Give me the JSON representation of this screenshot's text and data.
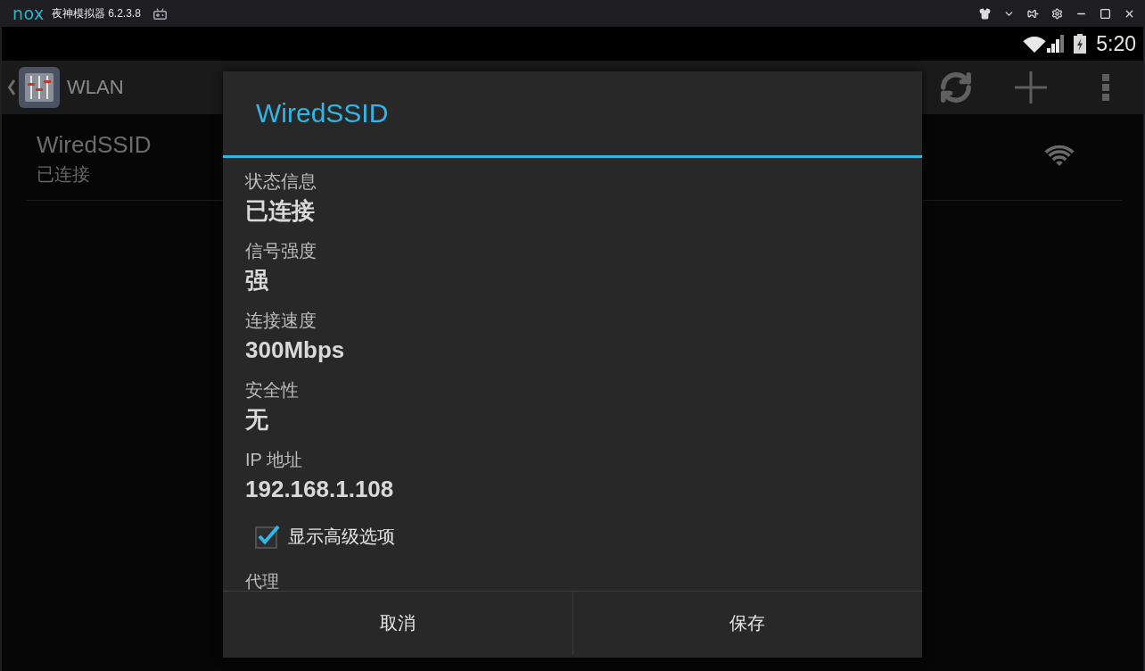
{
  "window": {
    "logo": "nox",
    "title": "夜神模拟器 6.2.3.8"
  },
  "status_bar": {
    "time": "5:20"
  },
  "action_bar": {
    "title": "WLAN"
  },
  "networks": [
    {
      "name": "WiredSSID",
      "status": "已连接"
    }
  ],
  "dialog": {
    "title": "WiredSSID",
    "fields": [
      {
        "label": "状态信息",
        "value": "已连接"
      },
      {
        "label": "信号强度",
        "value": "强"
      },
      {
        "label": "连接速度",
        "value": "300Mbps"
      },
      {
        "label": "安全性",
        "value": "无"
      },
      {
        "label": "IP 地址",
        "value": "192.168.1.108"
      }
    ],
    "show_advanced": {
      "label": "显示高级选项",
      "checked": true
    },
    "section": "代理",
    "buttons": [
      "取消",
      "保存"
    ]
  }
}
